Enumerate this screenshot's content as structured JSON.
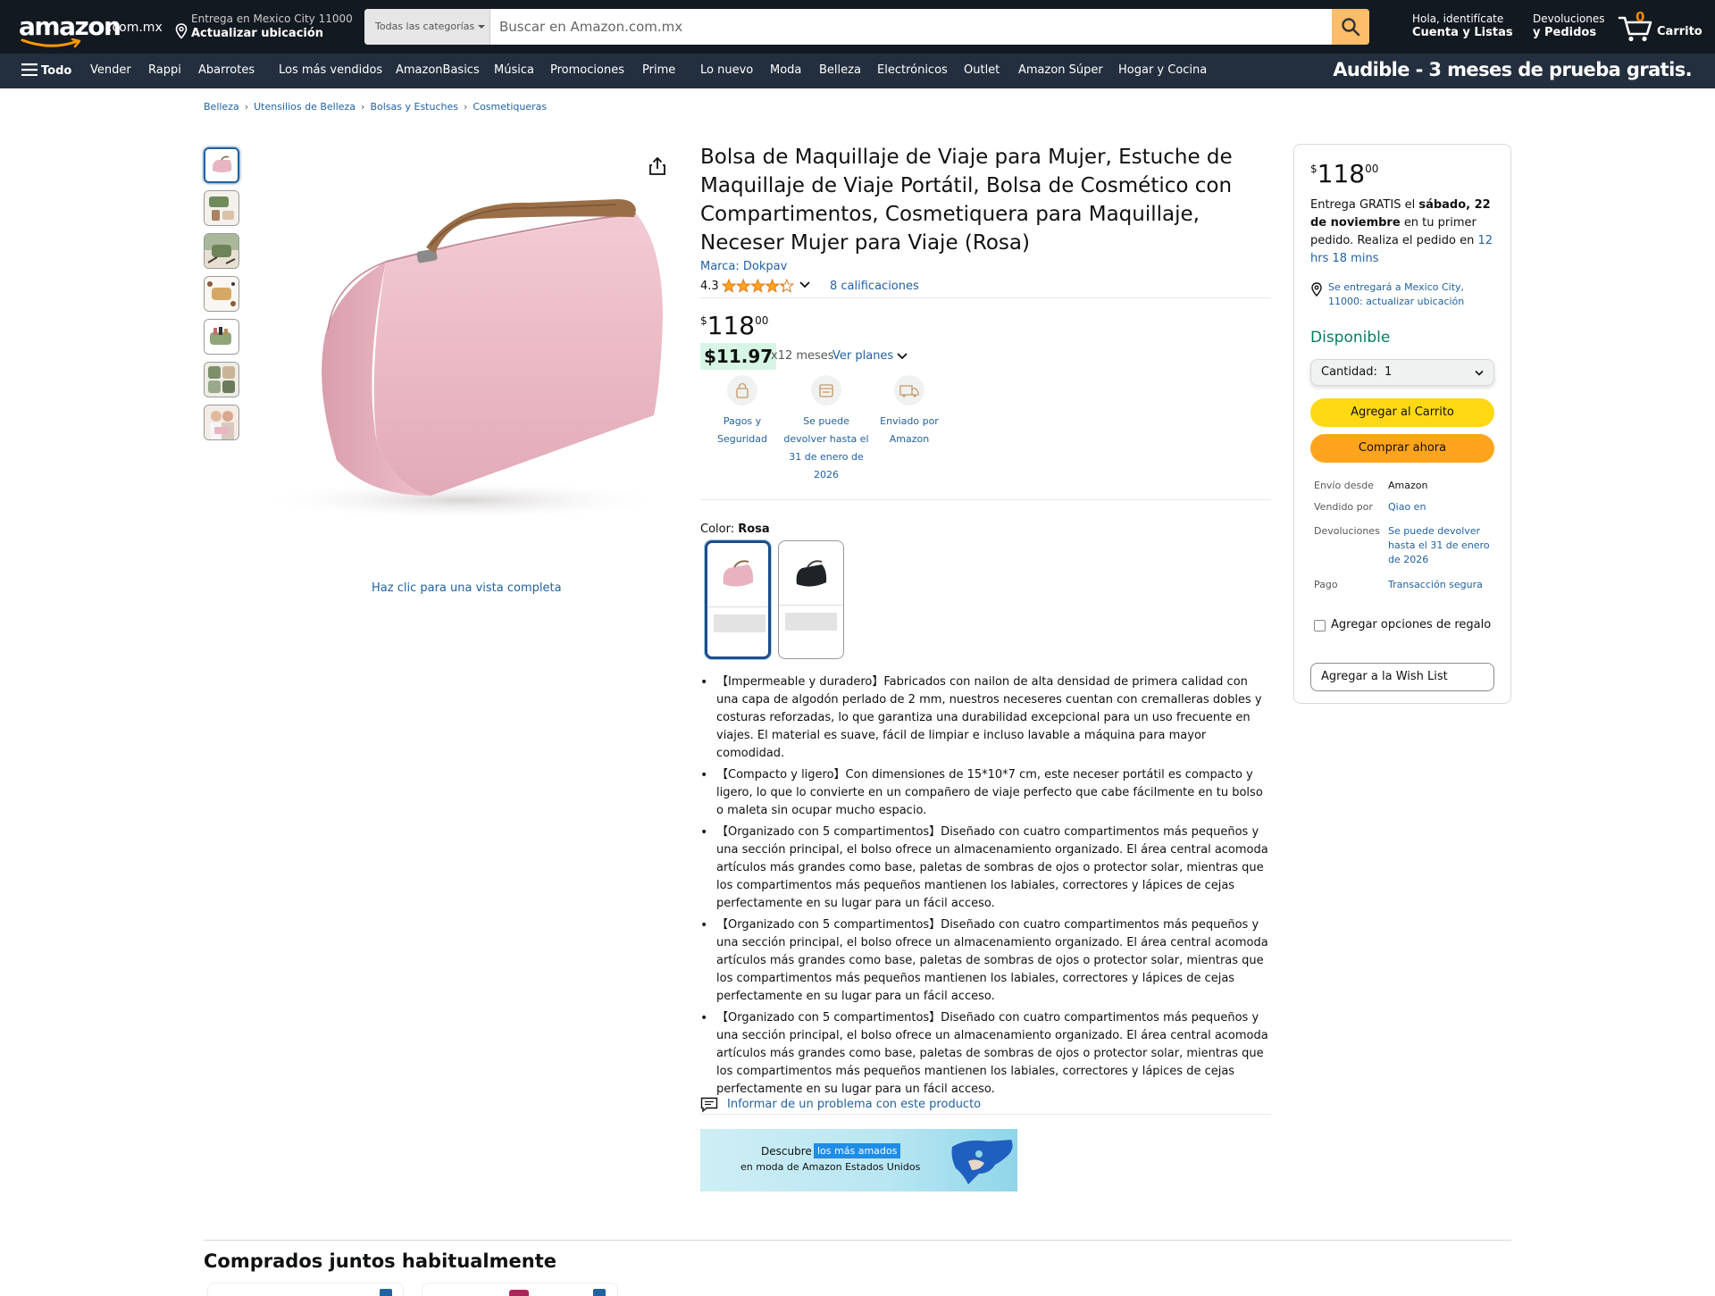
{
  "header": {
    "logo_text": "amazon",
    "logo_tld": ".com.mx",
    "deliver_line1": "Entrega en Mexico City 11000",
    "deliver_line2": "Actualizar ubicación",
    "search_category": "Todas las categorías",
    "search_placeholder": "Buscar en Amazon.com.mx",
    "account_line1": "Hola, identifícate",
    "account_line2": "Cuenta y Listas",
    "returns_line1": "Devoluciones",
    "returns_line2": "y Pedidos",
    "cart_count": "0",
    "cart_label": "Carrito"
  },
  "subnav": {
    "all_label": "Todo",
    "items": [
      "Vender",
      "Rappi",
      "Abarrotes",
      "Los más vendidos",
      "AmazonBasics",
      "Música",
      "Promociones",
      "Prime",
      "Lo nuevo",
      "Moda",
      "Belleza",
      "Electrónicos",
      "Outlet",
      "Amazon Súper",
      "Hogar y Cocina"
    ],
    "promo": "Audible - 3 meses de prueba gratis."
  },
  "breadcrumb": [
    "Belleza",
    "Utensilios de Belleza",
    "Bolsas y Estuches",
    "Cosmetiqueras"
  ],
  "gallery": {
    "thumbnail_count": 7,
    "full_view_label": "Haz clic para una vista completa"
  },
  "product": {
    "title": "Bolsa de Maquillaje de Viaje para Mujer, Estuche de Maquillaje de Viaje Portátil, Bolsa de Cosmético con Compartimentos, Cosmetiquera para Maquillaje, Neceser Mujer para Viaje (Rosa)",
    "brand": "Marca: Dokpav",
    "rating": "4.3",
    "rating_value": 4.3,
    "ratings_count": "8 calificaciones",
    "price_symbol": "$",
    "price_whole": "118",
    "price_fraction": "00",
    "installment_amount": "$11.97",
    "installment_text": "x12 meses",
    "installment_link": "Ver planes",
    "badges": [
      {
        "icon": "lock-icon",
        "label": "Pagos y Seguridad"
      },
      {
        "icon": "return-box-icon",
        "label": "Se puede devolver hasta el 31 de enero de 2026"
      },
      {
        "icon": "delivery-truck-icon",
        "label": "Enviado por Amazon"
      }
    ],
    "color_label": "Color:",
    "color_value": "Rosa",
    "swatches": [
      "Rosa",
      "Negro"
    ],
    "bullets": [
      "【Impermeable y duradero】Fabricados con nailon de alta densidad de primera calidad con una capa de algodón perlado de 2 mm, nuestros neceseres cuentan con cremalleras dobles y costuras reforzadas, lo que garantiza una durabilidad excepcional para un uso frecuente en viajes. El material es suave, fácil de limpiar e incluso lavable a máquina para mayor comodidad.",
      "【Compacto y ligero】Con dimensiones de 15*10*7 cm, este neceser portátil es compacto y ligero, lo que lo convierte en un compañero de viaje perfecto que cabe fácilmente en tu bolso o maleta sin ocupar mucho espacio.",
      "【Organizado con 5 compartimentos】Diseñado con cuatro compartimentos más pequeños y una sección principal, el bolso ofrece un almacenamiento organizado. El área central acomoda artículos más grandes como base, paletas de sombras de ojos o protector solar, mientras que los compartimentos más pequeños mantienen los labiales, correctores y lápices de cejas perfectamente en su lugar para un fácil acceso.",
      "【Organizado con 5 compartimentos】Diseñado con cuatro compartimentos más pequeños y una sección principal, el bolso ofrece un almacenamiento organizado. El área central acomoda artículos más grandes como base, paletas de sombras de ojos o protector solar, mientras que los compartimentos más pequeños mantienen los labiales, correctores y lápices de cejas perfectamente en su lugar para un fácil acceso.",
      "【Organizado con 5 compartimentos】Diseñado con cuatro compartimentos más pequeños y una sección principal, el bolso ofrece un almacenamiento organizado. El área central acomoda artículos más grandes como base, paletas de sombras de ojos o protector solar, mientras que los compartimentos más pequeños mantienen los labiales, correctores y lápices de cejas perfectamente en su lugar para un fácil acceso."
    ],
    "report_label": "Informar de un problema con este producto"
  },
  "banner": {
    "line1": "Descubre",
    "pill": "los más amados",
    "line2": "en moda de Amazon Estados Unidos"
  },
  "buybox": {
    "price_symbol": "$",
    "price_whole": "118",
    "price_fraction": "00",
    "delivery_pre": "Entrega GRATIS el",
    "delivery_date": "sábado, 22 de noviembre",
    "delivery_mid": "en tu primer pedido. Realiza el pedido en",
    "delivery_countdown": "12 hrs 18 mins",
    "location": "Se entregará a Mexico City, 11000: actualizar ubicación",
    "availability": "Disponible",
    "quantity_label": "Cantidad:",
    "quantity_value": "1",
    "add_to_cart": "Agregar al Carrito",
    "buy_now": "Comprar ahora",
    "ships_from_label": "Envío desde",
    "ships_from_value": "Amazon",
    "sold_by_label": "Vendido por",
    "sold_by_value": "Qiao en",
    "returns_label": "Devoluciones",
    "returns_value": "Se puede devolver hasta el 31 de enero de 2026",
    "payment_label": "Pago",
    "payment_value": "Transacción segura",
    "gift_label": "Agregar opciones de regalo",
    "wishlist": "Agregar a la Wish List"
  },
  "frequently_bought": {
    "title": "Comprados juntos habitualmente"
  },
  "colors": {
    "nav_dark": "#131921",
    "nav_sub": "#232f3e",
    "search_button": "#febd69",
    "add_to_cart": "#ffd814",
    "buy_now": "#ffa41c",
    "link": "#2162a1",
    "in_stock": "#067d62",
    "star": "#ffa41c"
  }
}
